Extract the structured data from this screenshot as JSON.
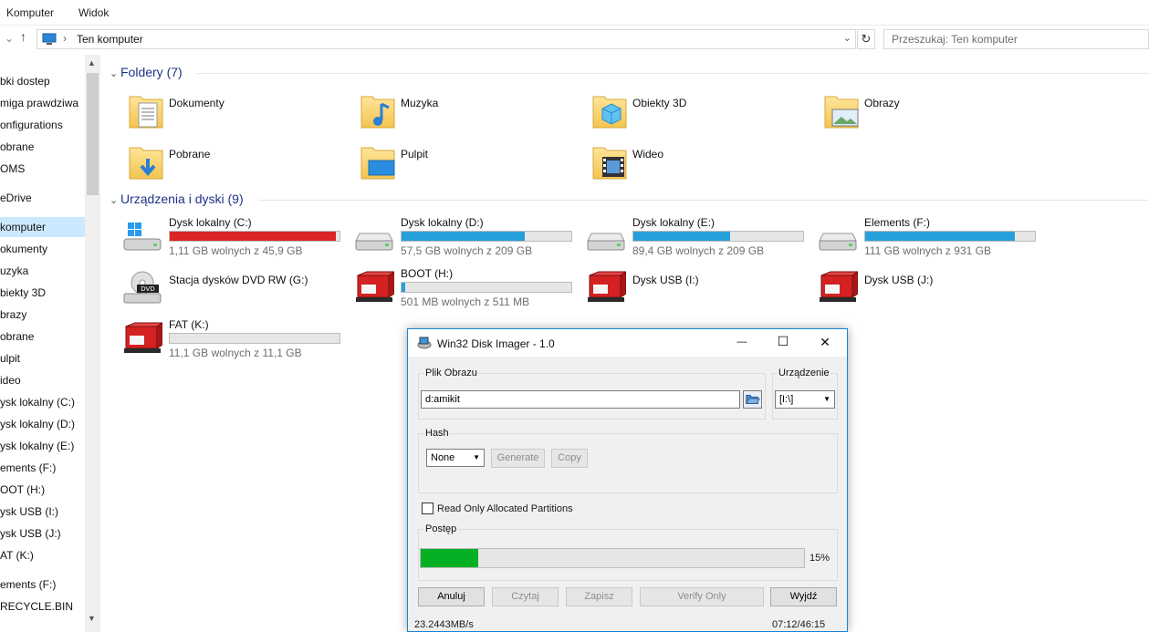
{
  "ribbon": {
    "menu": [
      "Komputer",
      "Widok"
    ]
  },
  "address": {
    "path": "Ten komputer",
    "search_placeholder": "Przeszukaj: Ten komputer"
  },
  "sidebar": {
    "items": [
      "bki dostep",
      "miga prawdziwa",
      "onfigurations",
      "obrane",
      "OMS",
      "eDrive",
      "komputer",
      "okumenty",
      "uzyka",
      "biekty 3D",
      "brazy",
      "obrane",
      "ulpit",
      "ideo",
      "ysk lokalny (C:)",
      "ysk lokalny (D:)",
      "ysk lokalny (E:)",
      "ements (F:)",
      "OOT (H:)",
      "ysk USB (I:)",
      "ysk USB (J:)",
      "AT (K:)",
      "ements (F:)",
      "RECYCLE.BIN"
    ],
    "selected_index": 6
  },
  "folders": {
    "header": "Foldery (7)",
    "items": [
      "Dokumenty",
      "Muzyka",
      "Obiekty 3D",
      "Obrazy",
      "Pobrane",
      "Pulpit",
      "Wideo"
    ]
  },
  "devices": {
    "header": "Urządzenia i dyski (9)",
    "items": [
      {
        "name": "Dysk lokalny (C:)",
        "free": "1,11 GB wolnych z 45,9 GB",
        "used_fraction": 0.976,
        "bar_color": "#da2626",
        "icon": "windows-drive-icon"
      },
      {
        "name": "Dysk lokalny (D:)",
        "free": "57,5 GB wolnych z 209 GB",
        "used_fraction": 0.725,
        "bar_color": "#26a0da",
        "icon": "hard-drive-icon"
      },
      {
        "name": "Dysk lokalny (E:)",
        "free": "89,4 GB wolnych z 209 GB",
        "used_fraction": 0.572,
        "bar_color": "#26a0da",
        "icon": "hard-drive-icon"
      },
      {
        "name": "Elements (F:)",
        "free": "111 GB wolnych z 931 GB",
        "used_fraction": 0.881,
        "bar_color": "#26a0da",
        "icon": "hard-drive-icon"
      },
      {
        "name": "Stacja dysków DVD RW (G:)",
        "free": "",
        "used_fraction": null,
        "bar_color": "",
        "icon": "dvd-drive-icon"
      },
      {
        "name": "BOOT (H:)",
        "free": "501 MB wolnych z 511 MB",
        "used_fraction": 0.02,
        "bar_color": "#26a0da",
        "icon": "usb-drive-icon"
      },
      {
        "name": "Dysk USB (I:)",
        "free": "",
        "used_fraction": null,
        "bar_color": "",
        "icon": "usb-drive-icon"
      },
      {
        "name": "Dysk USB (J:)",
        "free": "",
        "used_fraction": null,
        "bar_color": "",
        "icon": "usb-drive-icon"
      },
      {
        "name": "FAT (K:)",
        "free": "11,1 GB wolnych z 11,1 GB",
        "used_fraction": 0.0,
        "bar_color": "#26a0da",
        "icon": "usb-drive-icon"
      }
    ]
  },
  "dialog": {
    "title": "Win32 Disk Imager - 1.0",
    "image_group": "Plik Obrazu",
    "image_value": "d:amikit",
    "device_group": "Urządzenie",
    "device_value": "[I:\\]",
    "hash_group": "Hash",
    "hash_value": "None",
    "generate": "Generate",
    "copy": "Copy",
    "read_only": "Read Only Allocated Partitions",
    "progress_group": "Postęp",
    "progress_fraction": 0.15,
    "progress_text": "15%",
    "buttons": {
      "cancel": "Anuluj",
      "read": "Czytaj",
      "write": "Zapisz",
      "verify": "Verify Only",
      "exit": "Wyjdź"
    },
    "status_speed": "23.2443MB/s",
    "status_time": "07:12/46:15"
  }
}
